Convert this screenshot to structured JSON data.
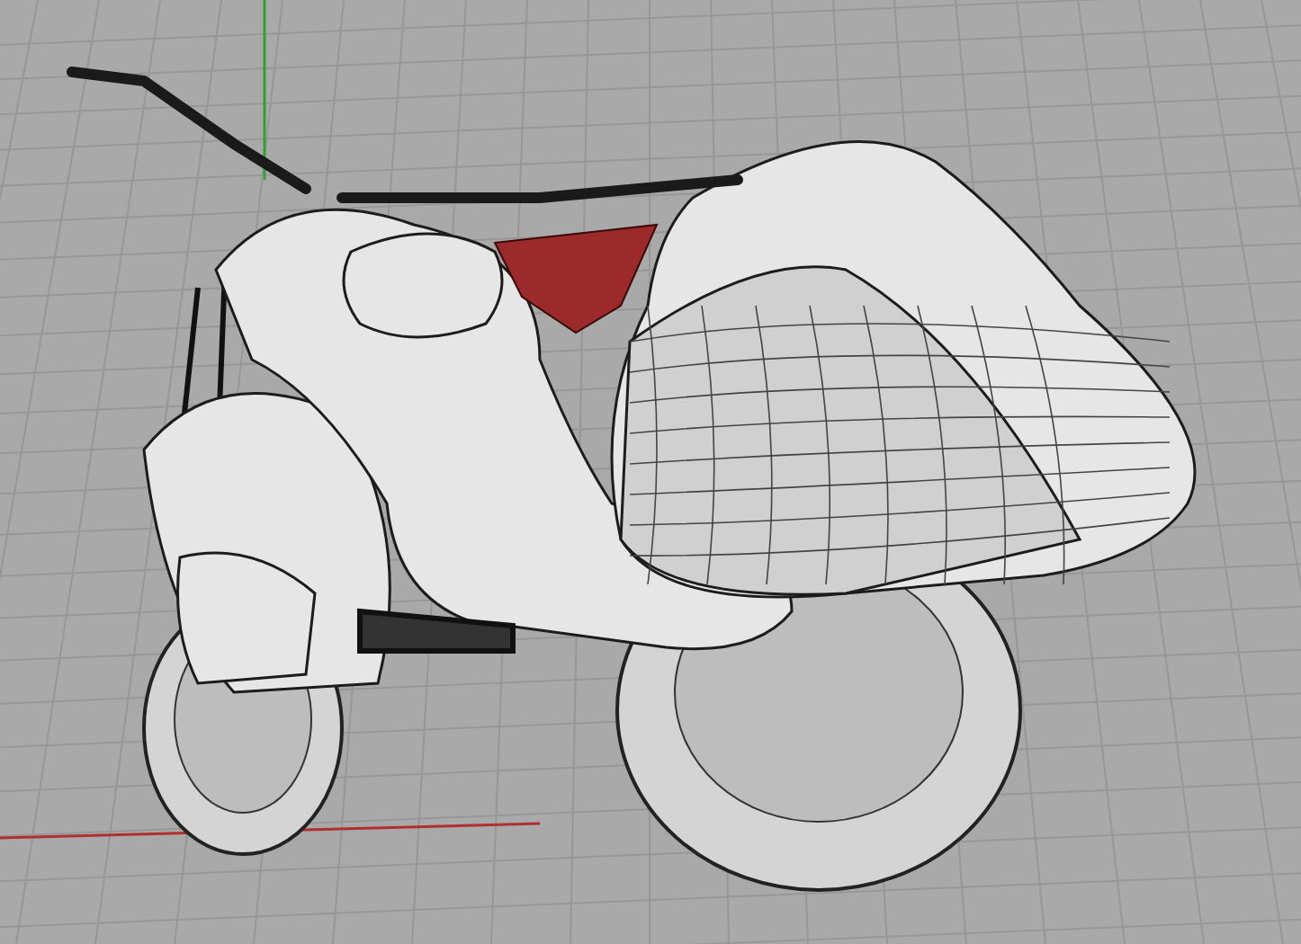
{
  "viewport": {
    "grid_visible": true,
    "axes_visible": true
  }
}
